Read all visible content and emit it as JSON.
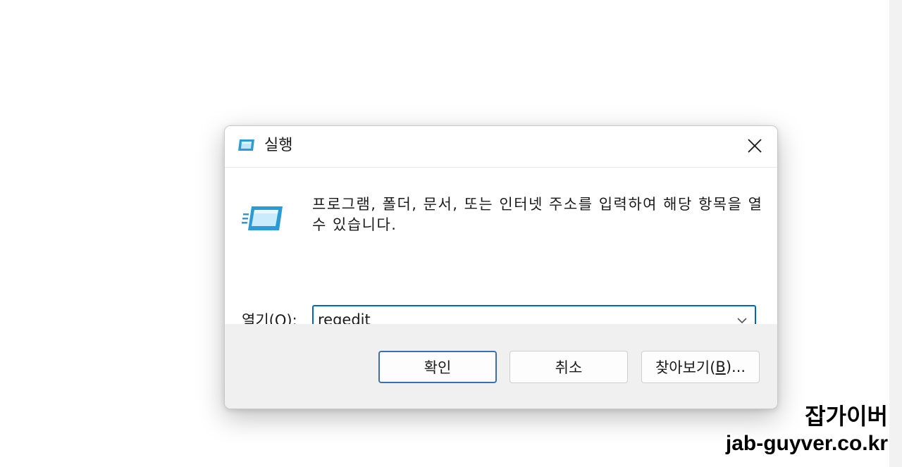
{
  "dialog": {
    "title": "실행",
    "description": "프로그램, 폴더, 문서, 또는 인터넷 주소를 입력하여 해당 항목을 열 수 있습니다.",
    "open_label_prefix": "열기(",
    "open_label_mnemonic": "O",
    "open_label_suffix": "):",
    "input_value": "regedit",
    "buttons": {
      "ok": "확인",
      "cancel": "취소",
      "browse_prefix": "찾아보기(",
      "browse_mnemonic": "B",
      "browse_suffix": ")..."
    },
    "icons": {
      "title": "run-icon",
      "body": "run-icon",
      "close": "close-icon",
      "dropdown": "chevron-down-icon"
    },
    "colors": {
      "accent": "#0067c0",
      "primary_button_border": "#3c6fb2",
      "footer_background": "#f0f0f0",
      "icon_blue": "#2a9bd8"
    }
  },
  "watermark": {
    "line1": "잡가이버",
    "line2": "jab-guyver.co.kr"
  }
}
